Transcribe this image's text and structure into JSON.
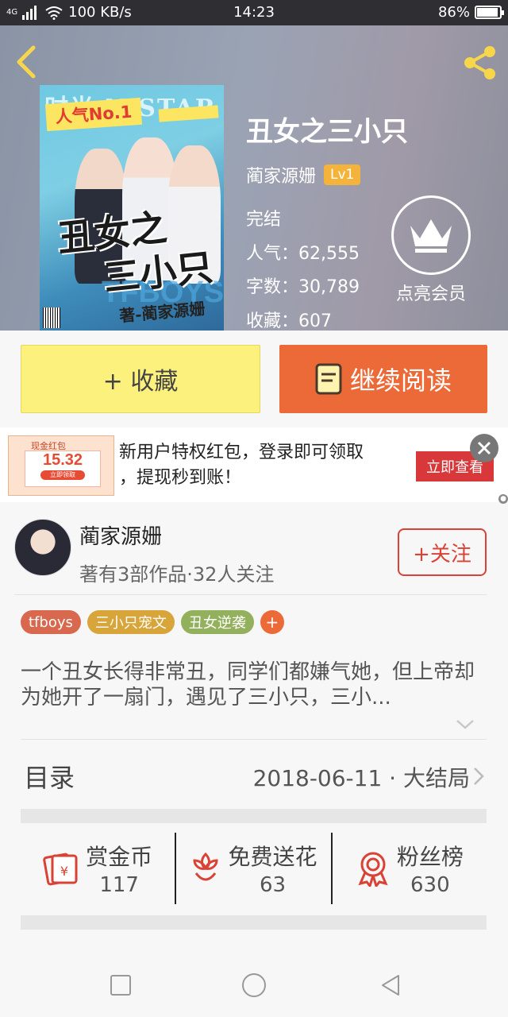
{
  "status_bar": {
    "network": "4G",
    "speed": "100 KB/s",
    "time": "14:23",
    "battery": "86%",
    "battery_level": 0.86
  },
  "header": {
    "back_icon": "chevron-left-icon",
    "share_icon": "share-icon"
  },
  "cover": {
    "badge": "人气No.1",
    "title_line1": "丑女之",
    "title_line2": "三小只",
    "brand": "TFBOYS",
    "signature": "著-蔺家源姗"
  },
  "book": {
    "title": "丑女之三小只",
    "author": "蔺家源姗",
    "level": "Lv1",
    "status": "完结",
    "popularity": "人气：62,555",
    "word_count": "字数：30,789",
    "favorites": "收藏：607",
    "vip_label": "点亮会员"
  },
  "actions": {
    "collect": "+ 收藏",
    "continue_read": "继续阅读"
  },
  "ad": {
    "thumb_title": "现金红包",
    "amount": "15.32",
    "thumb_button": "立即领取",
    "line1": "新用户特权红包，登录即可领取",
    "line2": "，提现秒到账！",
    "button": "立即查看"
  },
  "author_section": {
    "name": "蔺家源姗",
    "meta": "著有3部作品·32人关注",
    "follow": "+关注"
  },
  "tags": [
    {
      "label": "tfboys",
      "color": "#d9694e"
    },
    {
      "label": "三小只宠文",
      "color": "#d7a53a"
    },
    {
      "label": "丑女逆袭",
      "color": "#93b05c"
    }
  ],
  "tag_add": "+",
  "synopsis": "一个丑女长得非常丑，同学们都嫌气她，但上帝却为她开了一扇门，遇见了三小只，三小...",
  "toc": {
    "label": "目录",
    "update": "2018-06-11 · 大结局"
  },
  "stats": [
    {
      "label": "赏金币",
      "value": "117",
      "icon": "red-envelope-icon"
    },
    {
      "label": "免费送花",
      "value": "63",
      "icon": "flower-icon"
    },
    {
      "label": "粉丝榜",
      "value": "630",
      "icon": "medal-icon"
    }
  ],
  "colors": {
    "accent_orange": "#ec6a38",
    "collect_yellow": "#fdf17e",
    "follow_red": "#d94235",
    "level_badge": "#f4b33a"
  }
}
